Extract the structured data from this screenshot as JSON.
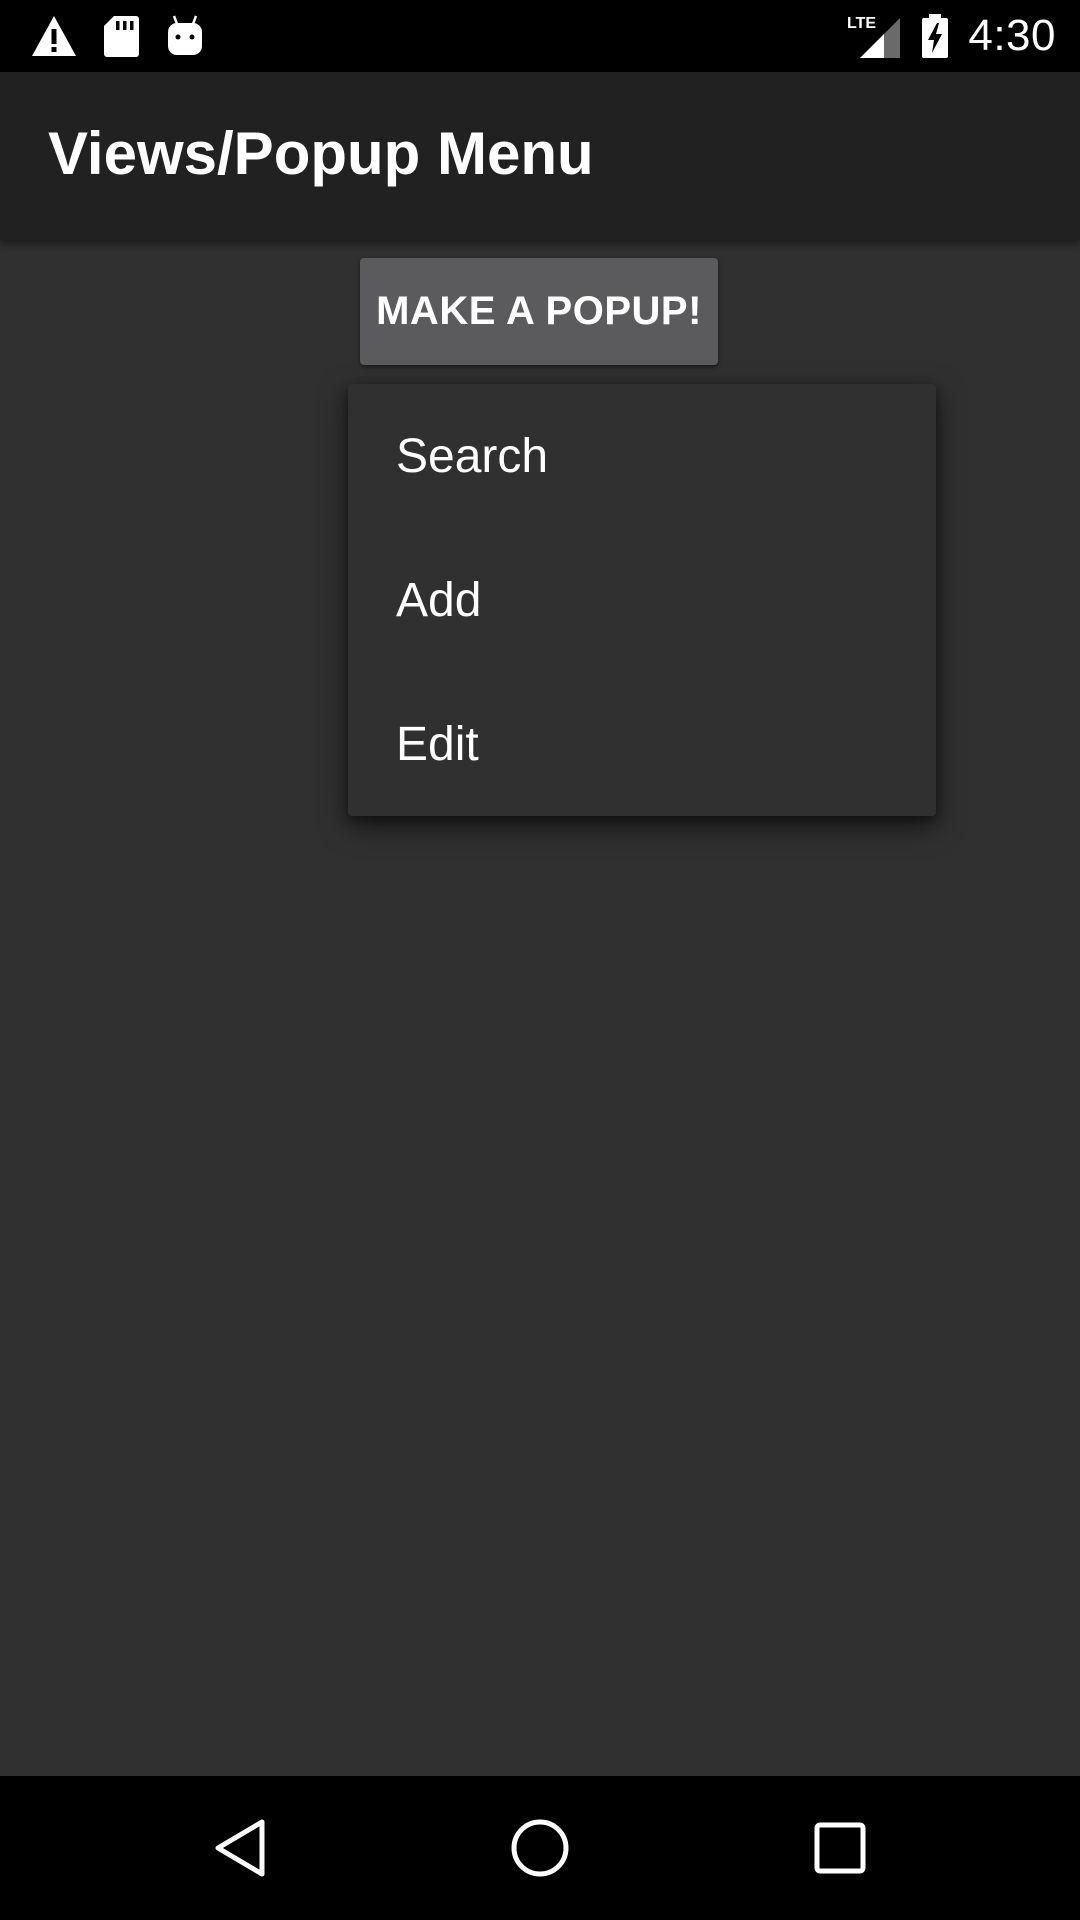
{
  "status_bar": {
    "time": "4:30",
    "network_label": "LTE",
    "icons": [
      "warning-icon",
      "sd-card-icon",
      "android-debug-icon",
      "lte-signal-icon",
      "battery-charging-icon"
    ]
  },
  "app_bar": {
    "title": "Views/Popup Menu"
  },
  "main": {
    "popup_button_label": "MAKE A POPUP!"
  },
  "popup_menu": {
    "items": [
      {
        "label": "Search"
      },
      {
        "label": "Add"
      },
      {
        "label": "Edit"
      }
    ]
  },
  "nav_bar": {
    "icons": [
      "back-icon",
      "home-icon",
      "recents-icon"
    ]
  },
  "colors": {
    "background": "#303030",
    "app_bar": "#212121",
    "button": "#5b5b5d",
    "status_bar": "#000000"
  }
}
